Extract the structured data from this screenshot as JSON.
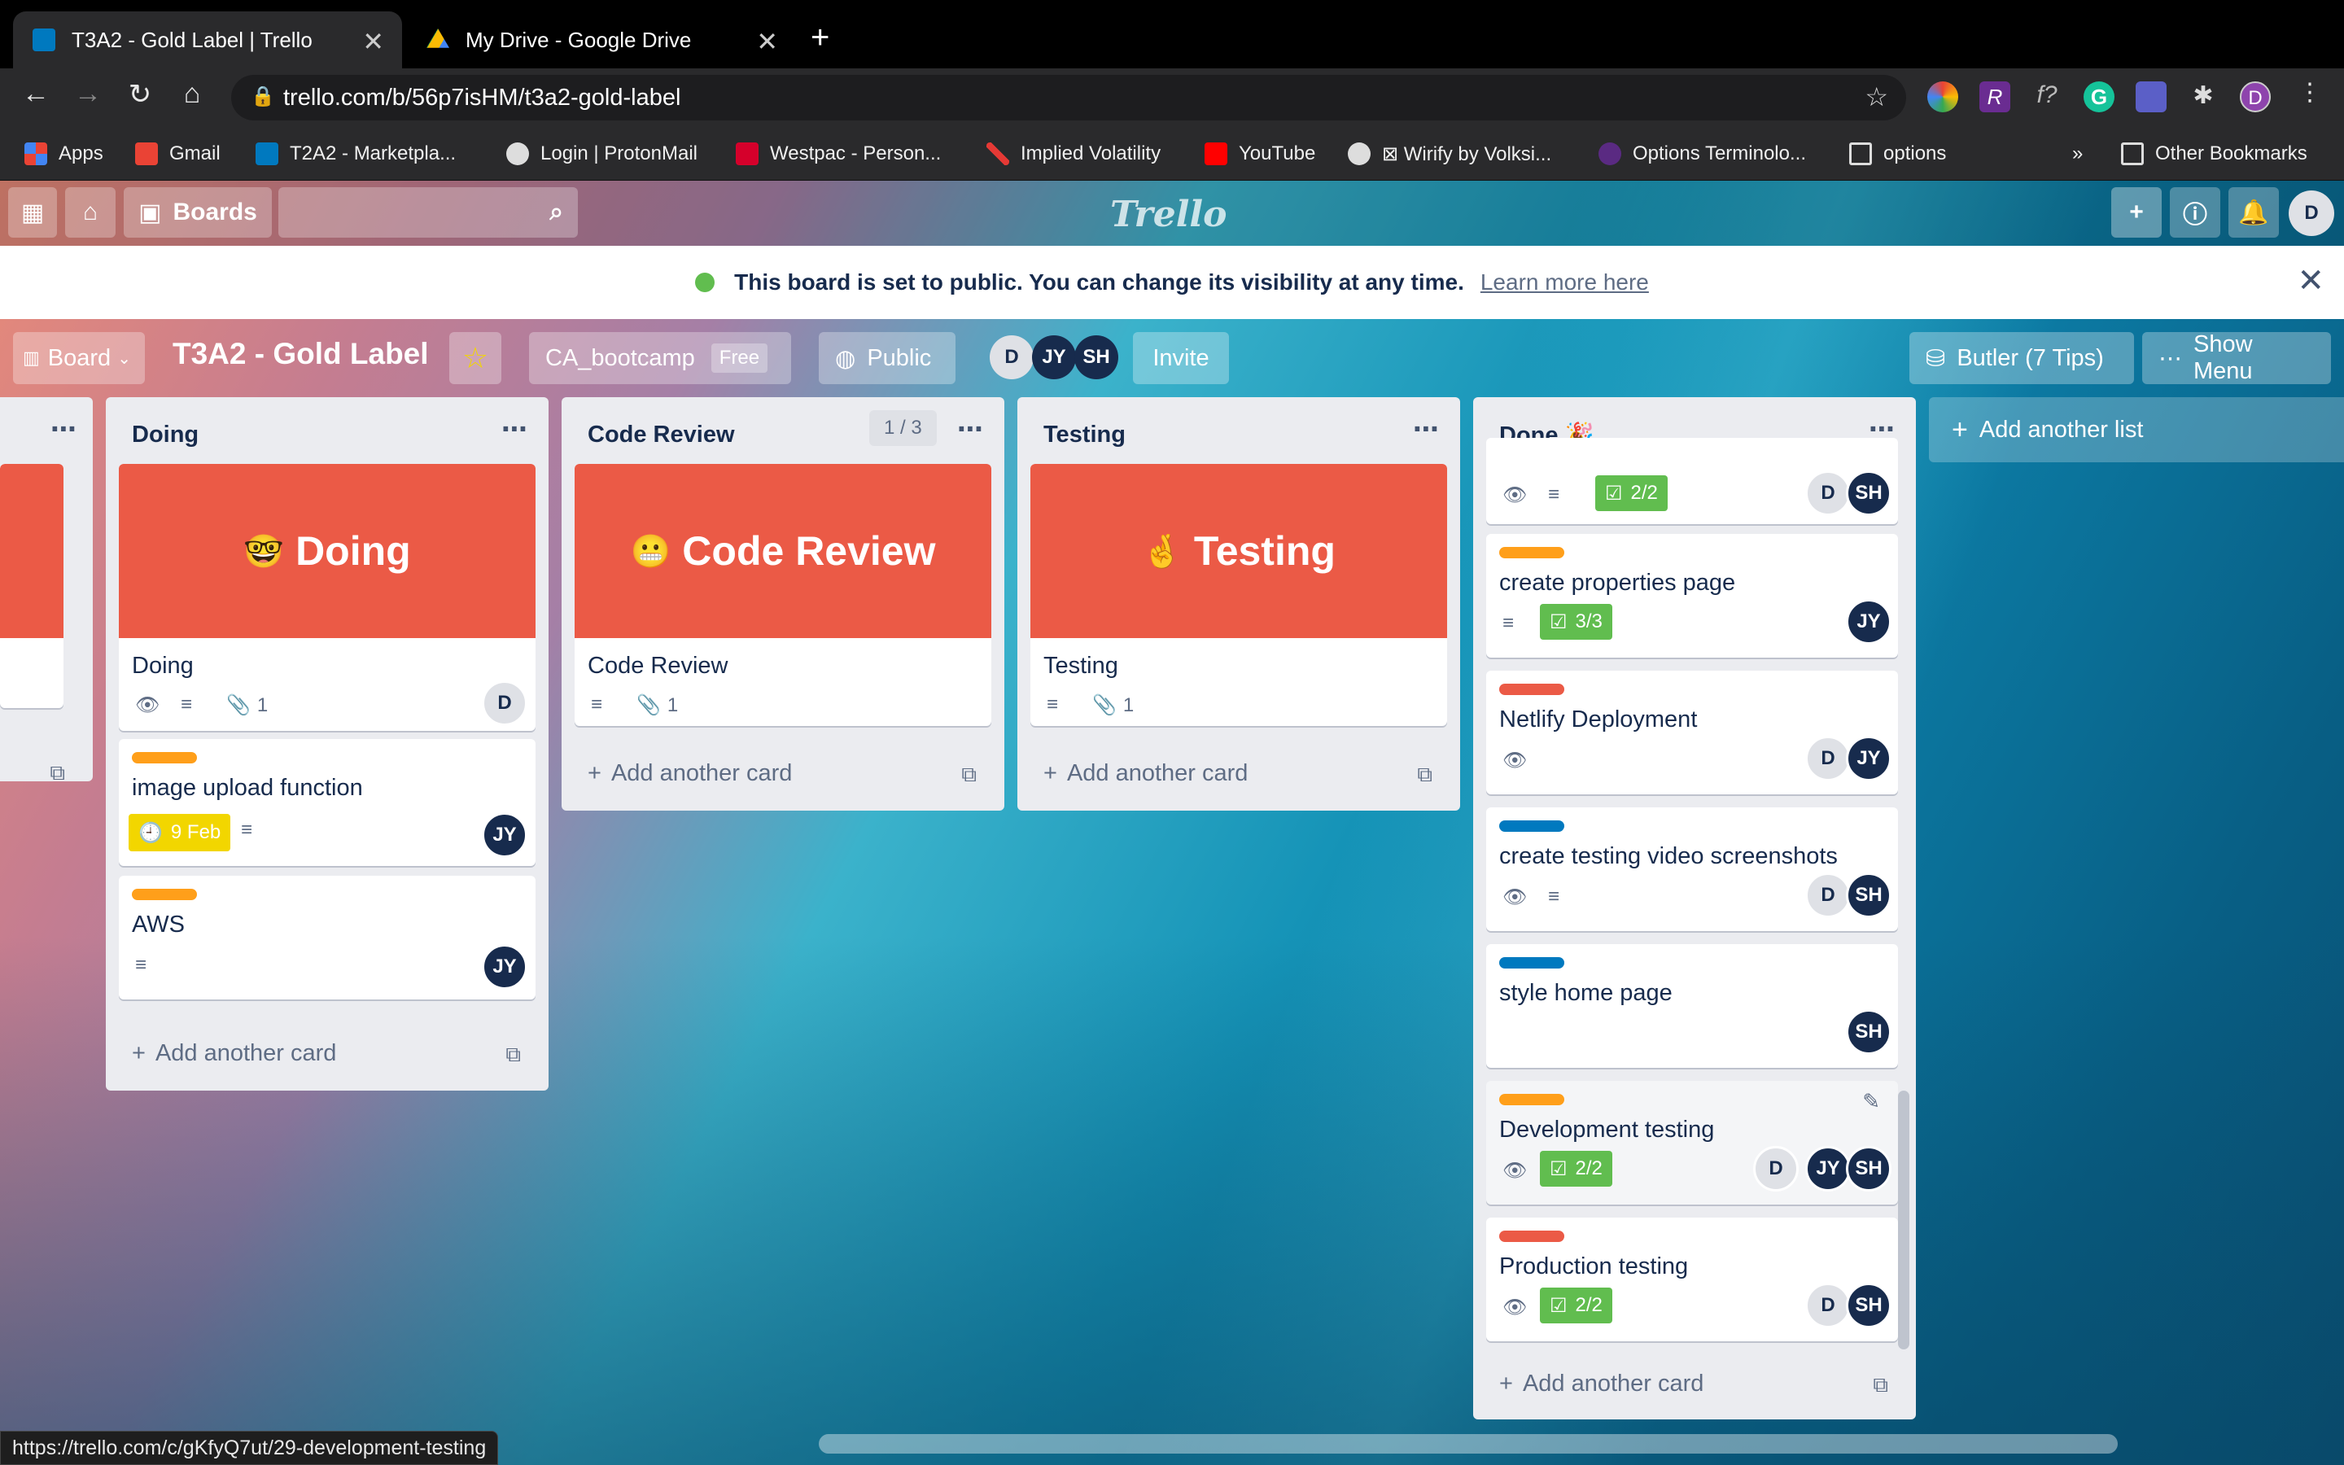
{
  "browser": {
    "tabs": [
      {
        "title": "T3A2 - Gold Label | Trello"
      },
      {
        "title": "My Drive - Google Drive"
      }
    ],
    "url": "trello.com/b/56p7isHM/t3a2-gold-label",
    "profile_initial": "D",
    "status_url": "https://trello.com/c/gKfyQ7ut/29-development-testing"
  },
  "bookmarks": {
    "items": [
      "Apps",
      "Gmail",
      "T2A2 - Marketpla...",
      "Login | ProtonMail",
      "Westpac - Person...",
      "Implied Volatility",
      "YouTube",
      "⊠ Wirify by Volksi...",
      "Options Terminolo...",
      "options"
    ],
    "overflow": "»",
    "other": "Other Bookmarks"
  },
  "trello_header": {
    "boards_label": "Boards",
    "logo": "Trello",
    "user_initial": "D"
  },
  "banner": {
    "text": "This board is set to public. You can change its visibility at any time.",
    "link": "Learn more here"
  },
  "board": {
    "view_label": "Board",
    "title": "T3A2 - Gold Label",
    "workspace": "CA_bootcamp",
    "plan_badge": "Free",
    "visibility": "Public",
    "members": [
      "D",
      "JY",
      "SH"
    ],
    "invite": "Invite",
    "butler": "Butler (7 Tips)",
    "show_menu": "Show Menu",
    "add_list": "Add another list"
  },
  "lists": {
    "doing": {
      "name": "Doing",
      "cover": "Doing",
      "cover_card_title": "Doing",
      "attachments": "1",
      "cards": [
        {
          "title": "image upload function",
          "due": "9 Feb",
          "member": "JY"
        },
        {
          "title": "AWS",
          "member": "JY"
        }
      ],
      "member": "D",
      "add_card": "Add another card"
    },
    "review": {
      "name": "Code Review",
      "limit": "1 / 3",
      "cover": "Code Review",
      "cover_card_title": "Code Review",
      "attachments": "1",
      "add_card": "Add another card"
    },
    "testing": {
      "name": "Testing",
      "cover": "Testing",
      "cover_card_title": "Testing",
      "attachments": "1",
      "add_card": "Add another card"
    },
    "done": {
      "name": "Done 🎉",
      "add_card": "Add another card",
      "cards": [
        {
          "title": "",
          "checklist": "2/2",
          "members": [
            "D",
            "SH"
          ]
        },
        {
          "title": "create properties page",
          "checklist": "3/3",
          "members": [
            "JY"
          ]
        },
        {
          "title": "Netlify Deployment",
          "members": [
            "D",
            "JY"
          ]
        },
        {
          "title": "create testing video screenshots",
          "members": [
            "D",
            "SH"
          ]
        },
        {
          "title": "style home page",
          "members": [
            "SH"
          ]
        },
        {
          "title": "Development testing",
          "checklist": "2/2",
          "members": [
            "D",
            "JY",
            "SH"
          ]
        },
        {
          "title": "Production testing",
          "checklist": "2/2",
          "members": [
            "D",
            "SH"
          ]
        }
      ]
    }
  },
  "colors": {
    "orange_label": "#ff9f1a",
    "red_label": "#eb5a46",
    "blue_label": "#0079bf",
    "green_check": "#61bd4f",
    "due_yellow": "#f2d600"
  }
}
